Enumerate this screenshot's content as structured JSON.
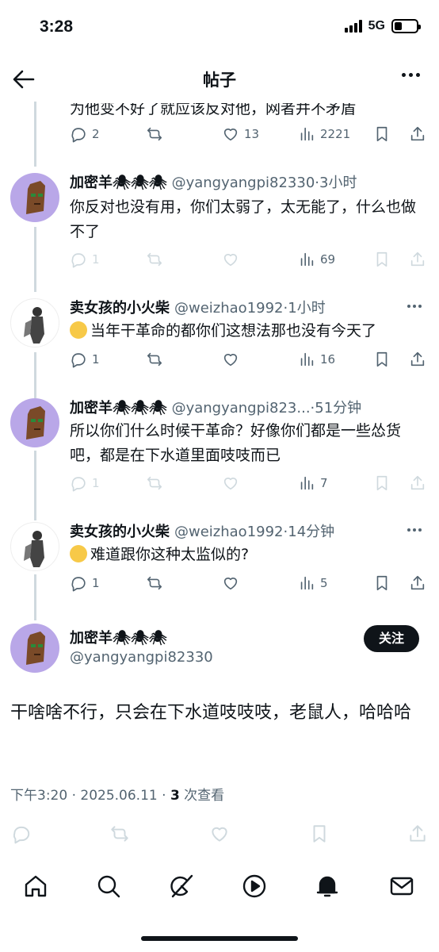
{
  "status": {
    "time": "3:28",
    "network": "5G",
    "battery_level": 0.35
  },
  "nav": {
    "title": "帖子"
  },
  "thread": {
    "partial_text": "为他变不好了就应该反对他，网者并不矛盾",
    "partial_stats": {
      "replies": "2",
      "reposts": "",
      "likes": "13",
      "views": "2221"
    },
    "replies": [
      {
        "avatar": "sheep",
        "name": "加密羊🕷🕷🕷",
        "handle": "@yangyangpi82330",
        "time": "·3小时",
        "text": "你反对也没有用，你们太弱了，太无能了，什么也做不了",
        "stats": {
          "replies": "1",
          "reposts": "",
          "likes": "",
          "views": "69"
        },
        "faded": true
      },
      {
        "avatar": "match",
        "name": "卖女孩的小火柴",
        "handle": "@weizhao1992",
        "time": "·1小时",
        "emoji": "rofl",
        "text": "当年干革命的都你们这想法那也没有今天了",
        "stats": {
          "replies": "1",
          "reposts": "",
          "likes": "",
          "views": "16"
        },
        "faded": false
      },
      {
        "avatar": "sheep",
        "name": "加密羊🕷🕷🕷",
        "handle": "@yangyangpi823...",
        "time": "·51分钟",
        "text": "所以你们什么时候干革命？好像你们都是一些怂货吧，都是在下水道里面吱吱而已",
        "stats": {
          "replies": "1",
          "reposts": "",
          "likes": "",
          "views": "7"
        },
        "faded": true
      },
      {
        "avatar": "match",
        "name": "卖女孩的小火柴",
        "handle": "@weizhao1992",
        "time": "·14分钟",
        "emoji": "rofl",
        "text": "难道跟你这种太监似的?",
        "stats": {
          "replies": "1",
          "reposts": "",
          "likes": "",
          "views": "5"
        },
        "faded": false
      }
    ]
  },
  "main_post": {
    "name": "加密羊🕷🕷🕷",
    "handle": "@yangyangpi82330",
    "follow_label": "关注",
    "text": "干啥啥不行，只会在下水道吱吱吱，老鼠人，哈哈哈",
    "timestamp": "下午3:20 · 2025.06.11 · ",
    "views_count": "3",
    "views_label": " 次查看"
  },
  "tabbar": {
    "items": [
      "home-icon",
      "search-icon",
      "grok-icon",
      "video-icon",
      "notifications-icon",
      "messages-icon"
    ]
  }
}
